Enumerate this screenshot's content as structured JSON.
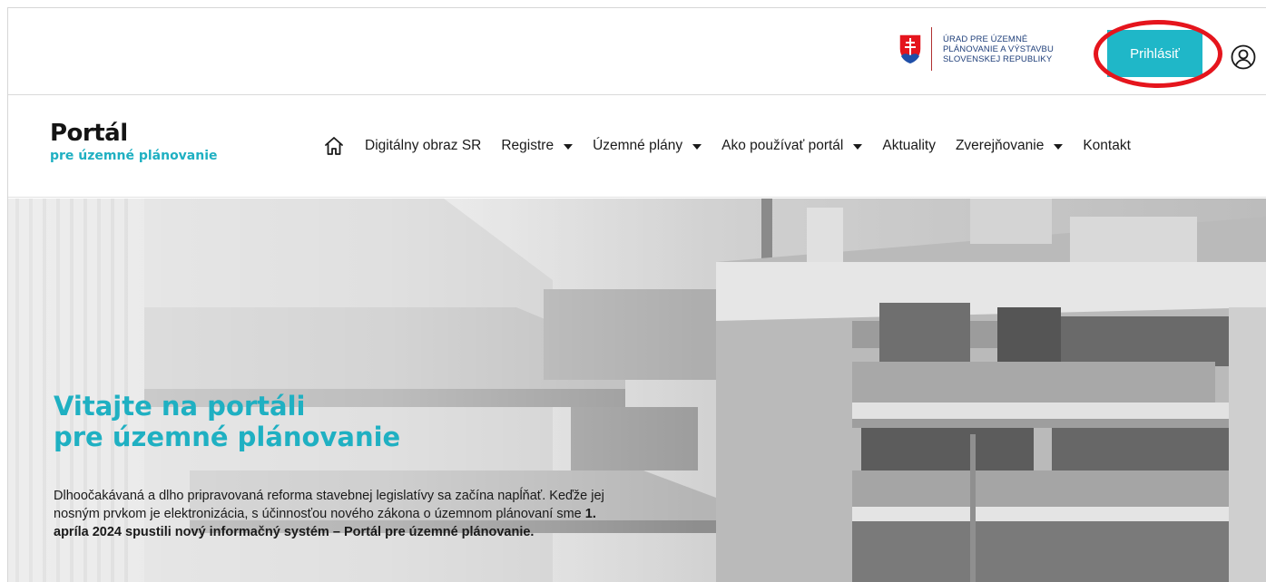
{
  "header": {
    "gov_logo_lines": [
      "ÚRAD PRE ÚZEMNÉ",
      "PLÁNOVANIE A VÝSTAVBU",
      "SLOVENSKEJ REPUBLIKY"
    ],
    "login_label": "Prihlásiť",
    "highlight_color": "#e5151d",
    "accent_color": "#1fb7c8"
  },
  "logo": {
    "title": "Portál",
    "subtitle": "pre územné plánovanie"
  },
  "nav": {
    "items": [
      {
        "label": "Digitálny obraz SR",
        "dropdown": false
      },
      {
        "label": "Registre",
        "dropdown": true
      },
      {
        "label": "Územné plány",
        "dropdown": true
      },
      {
        "label": "Ako používať portál",
        "dropdown": true
      },
      {
        "label": "Aktuality",
        "dropdown": false
      },
      {
        "label": "Zverejňovanie",
        "dropdown": true
      },
      {
        "label": "Kontakt",
        "dropdown": false
      }
    ]
  },
  "hero": {
    "title_line1": "Vitajte na portáli",
    "title_line2": "pre územné plánovanie",
    "text_part1": "Dlhoočakávaná a dlho pripravovaná reforma stavebnej legislatívy sa začína napĺňať. Keďže jej nosným prvkom je elektronizácia, s účinnosťou nového zákona o územnom plánovaní sme ",
    "text_bold": "1. apríla 2024 spustili nový informačný systém – Portál pre územné plánovanie."
  }
}
